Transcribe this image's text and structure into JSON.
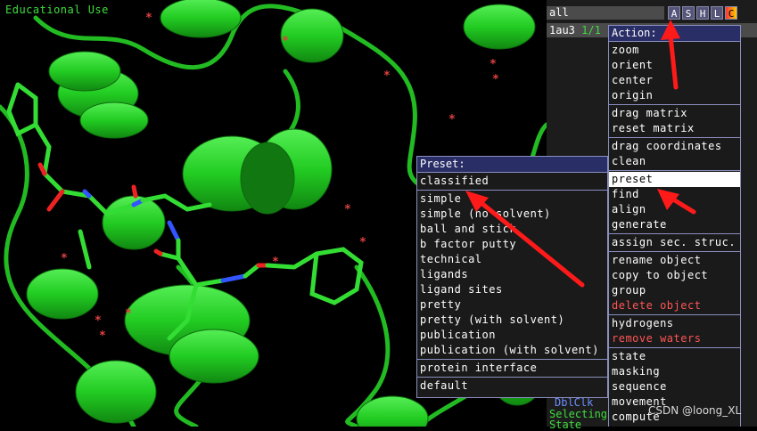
{
  "viewport": {
    "watermark_text": "Educational Use"
  },
  "object_panel": {
    "filter_value": "all",
    "buttons": [
      "A",
      "S",
      "H",
      "L",
      "C"
    ],
    "object_name": "1au3",
    "object_state": "1/1",
    "bottom_lines": [
      "DblClk",
      "Selecting",
      "State"
    ]
  },
  "preset_menu": {
    "title": "Preset:",
    "groups": [
      [
        "classified"
      ],
      [
        "simple",
        "simple (no solvent)",
        "ball and stick",
        "b factor putty",
        "technical",
        "ligands",
        "ligand sites",
        "pretty",
        "pretty (with solvent)",
        "publication",
        "publication (with solvent)"
      ],
      [
        "protein interface"
      ],
      [
        "default"
      ]
    ]
  },
  "action_menu": {
    "title": "Action:",
    "groups": [
      [
        "zoom",
        "orient",
        "center",
        "origin"
      ],
      [
        "drag matrix",
        "reset matrix"
      ],
      [
        "drag coordinates",
        "clean"
      ],
      [
        "preset",
        "find",
        "align",
        "generate"
      ],
      [
        "assign sec. struc."
      ],
      [
        "rename object",
        "copy to object",
        "group",
        "delete object"
      ],
      [
        "hydrogens",
        "remove waters"
      ],
      [
        "state",
        "masking",
        "sequence",
        "movement",
        "compute"
      ]
    ],
    "selected": "preset",
    "red_items": [
      "delete object",
      "remove waters"
    ]
  },
  "credit": "CSDN @loong_XL",
  "colors": {
    "ribbon": "#22cc22",
    "menu_title_bg": "#2a2e66",
    "menu_border": "#8a8fc0",
    "arrow": "#ff1a1a"
  }
}
